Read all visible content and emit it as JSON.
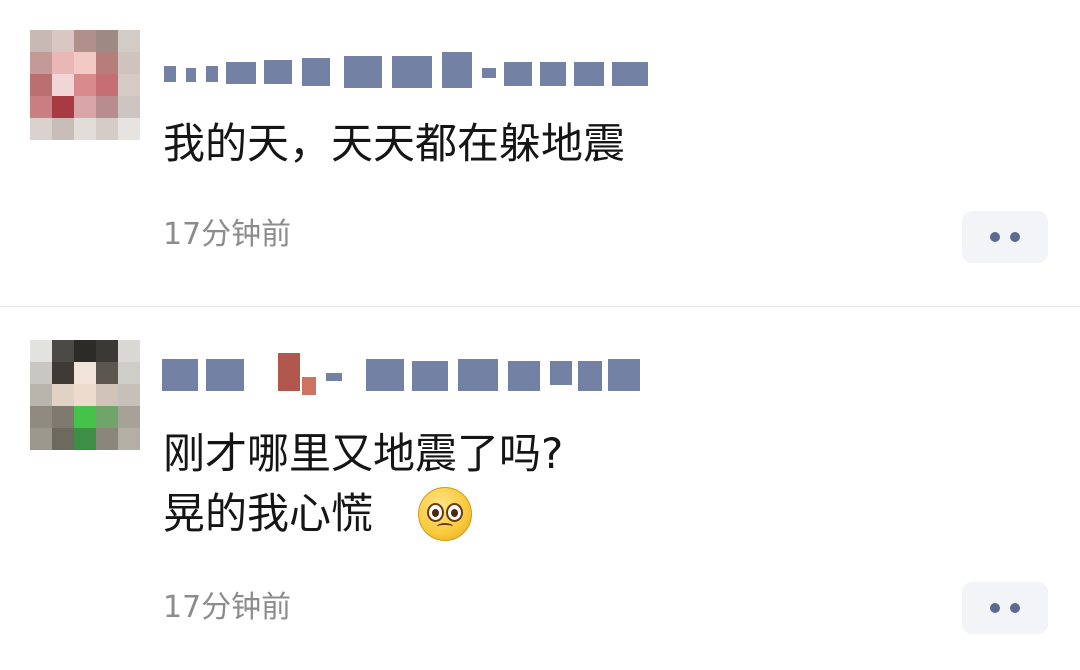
{
  "comments": [
    {
      "username": "••••••••••••••••••••",
      "text": "我的天，天天都在躲地震",
      "time": "17分钟前",
      "more_icon": "more-dots-icon"
    },
    {
      "username": "•••••••••••••••••",
      "text": "刚才哪里又地震了吗?\n晃的我心慌",
      "emoji": "pleading-face-emoji",
      "time": "17分钟前",
      "more_icon": "more-dots-icon"
    }
  ],
  "colors": {
    "username": "#5b6b94",
    "text": "#151515",
    "timestamp": "#8c8c8c",
    "more_button_bg": "#f3f4f8",
    "more_dots": "#5d6a90",
    "divider": "#e6e6e6"
  }
}
